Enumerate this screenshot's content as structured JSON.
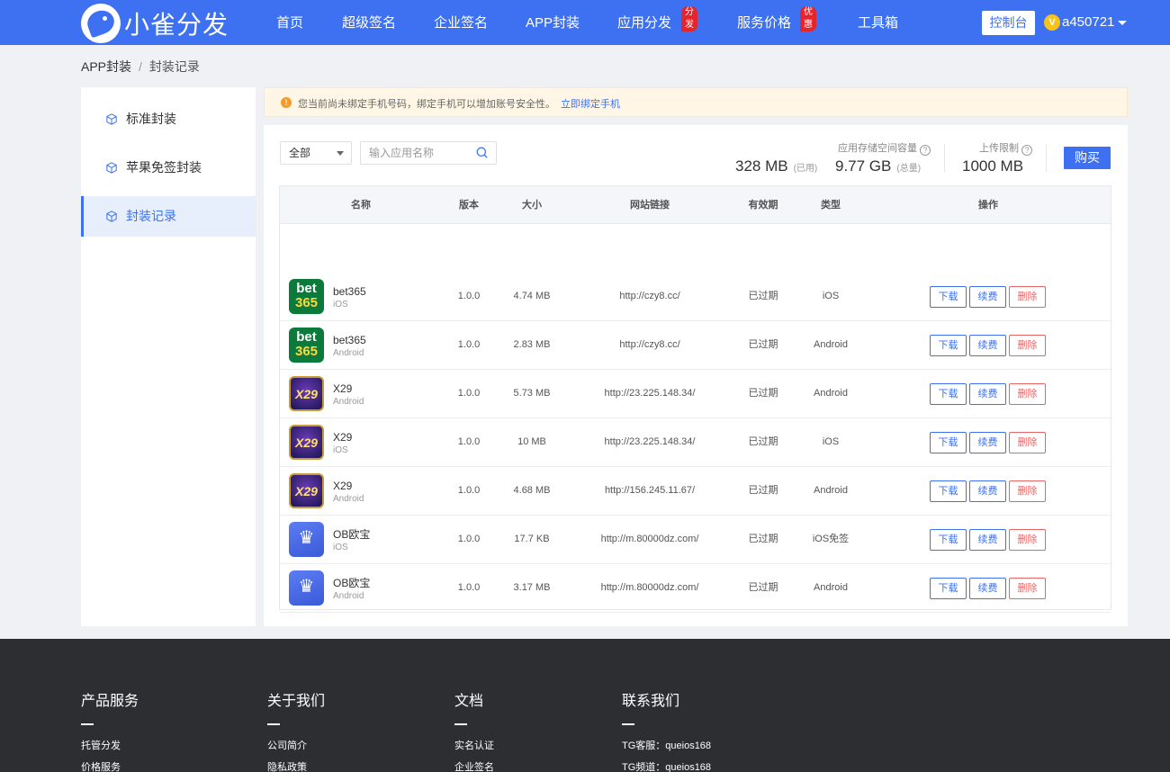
{
  "header": {
    "logo_text": "小雀分发",
    "nav": [
      {
        "label": "首页",
        "badge": ""
      },
      {
        "label": "超级签名",
        "badge": ""
      },
      {
        "label": "企业签名",
        "badge": ""
      },
      {
        "label": "APP封装",
        "badge": ""
      },
      {
        "label": "应用分发",
        "badge": "分发"
      },
      {
        "label": "服务价格",
        "badge": "优惠"
      },
      {
        "label": "工具箱",
        "badge": ""
      }
    ],
    "console_label": "控制台",
    "vip_letter": "V",
    "username": "a450721"
  },
  "breadcrumb": {
    "root": "APP封装",
    "separator": "/",
    "current": "封装记录"
  },
  "sidebar": {
    "items": [
      {
        "label": "标准封装",
        "active": false
      },
      {
        "label": "苹果免签封装",
        "active": false
      },
      {
        "label": "封装记录",
        "active": true
      }
    ]
  },
  "notice": {
    "icon": "!",
    "text": "您当前尚未绑定手机号码，绑定手机可以增加账号安全性。",
    "link": "立即绑定手机"
  },
  "toolbar": {
    "filter_value": "全部",
    "search_placeholder": "输入应用名称"
  },
  "storage": {
    "label": "应用存储空间容量",
    "used_value": "328 MB",
    "used_label": "(已用)",
    "total_value": "9.77 GB",
    "total_label": "(总量)",
    "upload_label": "上传限制",
    "upload_value": "1000 MB",
    "help": "?",
    "buy_label": "购买"
  },
  "table": {
    "headers": {
      "name": "名称",
      "version": "版本",
      "size": "大小",
      "url": "网站链接",
      "validity": "有效期",
      "type": "类型",
      "actions": "操作"
    },
    "action_labels": {
      "download": "下载",
      "renew": "续费",
      "delete": "删除"
    },
    "rows": [
      {
        "icon": "bet365",
        "name": "bet365",
        "platform": "iOS",
        "version": "1.0.0",
        "size": "4.74 MB",
        "url": "http://czy8.cc/",
        "validity": "已过期",
        "type": "iOS"
      },
      {
        "icon": "bet365",
        "name": "bet365",
        "platform": "Android",
        "version": "1.0.0",
        "size": "2.83 MB",
        "url": "http://czy8.cc/",
        "validity": "已过期",
        "type": "Android"
      },
      {
        "icon": "x29",
        "name": "X29",
        "platform": "Android",
        "version": "1.0.0",
        "size": "5.73 MB",
        "url": "http://23.225.148.34/",
        "validity": "已过期",
        "type": "Android"
      },
      {
        "icon": "x29",
        "name": "X29",
        "platform": "iOS",
        "version": "1.0.0",
        "size": "10 MB",
        "url": "http://23.225.148.34/",
        "validity": "已过期",
        "type": "iOS"
      },
      {
        "icon": "x29",
        "name": "X29",
        "platform": "Android",
        "version": "1.0.0",
        "size": "4.68 MB",
        "url": "http://156.245.11.67/",
        "validity": "已过期",
        "type": "Android"
      },
      {
        "icon": "ob",
        "name": "OB欧宝",
        "platform": "iOS",
        "version": "1.0.0",
        "size": "17.7 KB",
        "url": "http://m.80000dz.com/",
        "validity": "已过期",
        "type": "iOS免签"
      },
      {
        "icon": "ob",
        "name": "OB欧宝",
        "platform": "Android",
        "version": "1.0.0",
        "size": "3.17 MB",
        "url": "http://m.80000dz.com/",
        "validity": "已过期",
        "type": "Android"
      }
    ]
  },
  "footer": {
    "columns": [
      {
        "title": "产品服务",
        "links": [
          "托管分发",
          "价格服务"
        ]
      },
      {
        "title": "关于我们",
        "links": [
          "公司简介",
          "隐私政策"
        ]
      },
      {
        "title": "文档",
        "links": [
          "实名认证",
          "企业签名"
        ]
      },
      {
        "title": "联系我们",
        "links": [
          "TG客服：queios168",
          "TG频道：queios168"
        ]
      }
    ]
  }
}
